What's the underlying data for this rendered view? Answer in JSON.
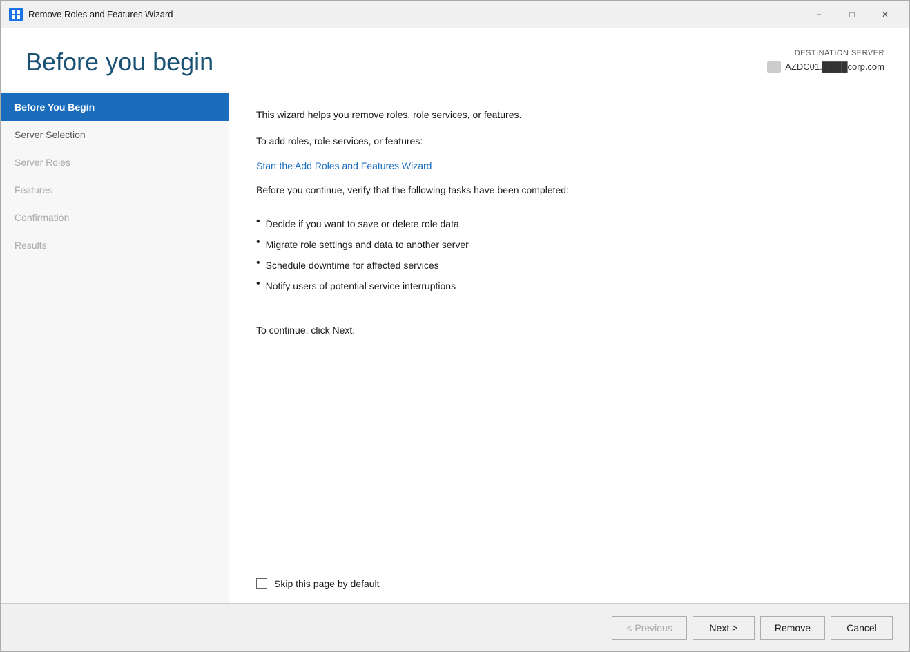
{
  "titlebar": {
    "title": "Remove Roles and Features Wizard",
    "minimize_label": "−",
    "maximize_label": "□",
    "close_label": "✕"
  },
  "wizard": {
    "title": "Before you begin",
    "destination_server_label": "DESTINATION SERVER",
    "destination_server_name": "AZDC01.████corp.com"
  },
  "sidebar": {
    "items": [
      {
        "label": "Before You Begin",
        "state": "active"
      },
      {
        "label": "Server Selection",
        "state": "normal"
      },
      {
        "label": "Server Roles",
        "state": "disabled"
      },
      {
        "label": "Features",
        "state": "disabled"
      },
      {
        "label": "Confirmation",
        "state": "disabled"
      },
      {
        "label": "Results",
        "state": "disabled"
      }
    ]
  },
  "content": {
    "intro": "This wizard helps you remove roles, role services, or features.",
    "add_roles_prompt": "To add roles, role services, or features:",
    "add_roles_link": "Start the Add Roles and Features Wizard",
    "verify_text": "Before you continue, verify that the following tasks have been completed:",
    "bullets": [
      "Decide if you want to save or delete role data",
      "Migrate role settings and data to another server",
      "Schedule downtime for affected services",
      "Notify users of potential service interruptions"
    ],
    "continue_text": "To continue, click Next.",
    "checkbox_label": "Skip this page by default"
  },
  "footer": {
    "previous_label": "< Previous",
    "next_label": "Next >",
    "remove_label": "Remove",
    "cancel_label": "Cancel"
  }
}
